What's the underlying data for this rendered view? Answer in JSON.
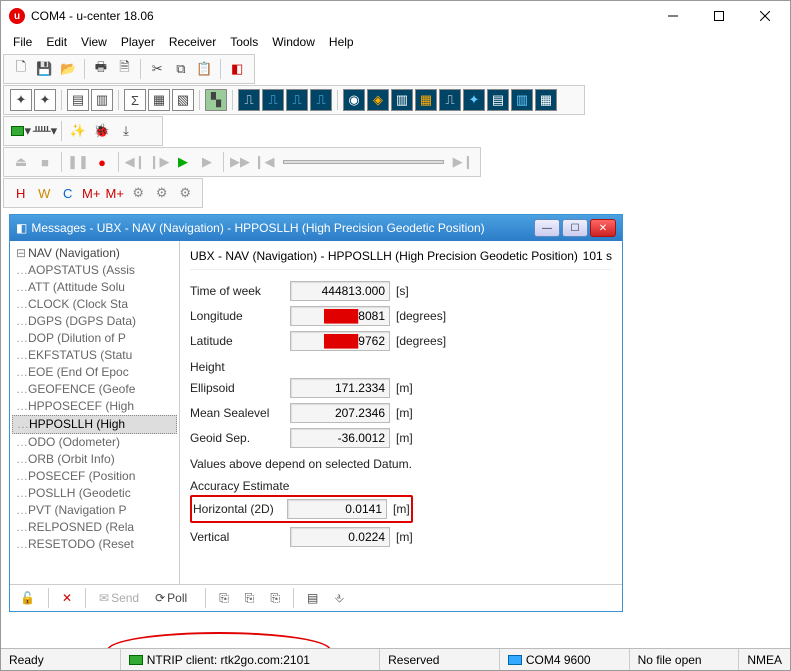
{
  "window": {
    "title": "COM4 - u-center 18.06"
  },
  "menu": [
    "File",
    "Edit",
    "View",
    "Player",
    "Receiver",
    "Tools",
    "Window",
    "Help"
  ],
  "messages": {
    "title": "Messages - UBX - NAV (Navigation) - HPPOSLLH (High Precision Geodetic Position)",
    "tree_root": "NAV (Navigation)",
    "tree": [
      "AOPSTATUS (Assis",
      "ATT (Attitude Solu",
      "CLOCK (Clock Sta",
      "DGPS (DGPS Data)",
      "DOP (Dilution of P",
      "EKFSTATUS (Statu",
      "EOE (End Of Epoc",
      "GEOFENCE (Geofe",
      "HPPOSECEF (High",
      "HPPOSLLH (High",
      "ODO (Odometer)",
      "ORB (Orbit Info)",
      "POSECEF (Position",
      "POSLLH (Geodetic",
      "PVT (Navigation P",
      "RELPOSNED (Rela",
      "RESETODO (Reset"
    ],
    "tree_selected_index": 9,
    "detail": {
      "header": "UBX - NAV (Navigation) - HPPOSLLH (High Precision Geodetic Position)",
      "age": "101 s",
      "time_of_week": {
        "label": "Time of week",
        "value": "444813.000",
        "unit": "[s]"
      },
      "longitude": {
        "label": "Longitude",
        "value": "8081",
        "unit": "[degrees]"
      },
      "latitude": {
        "label": "Latitude",
        "value": "9762",
        "unit": "[degrees]"
      },
      "height_label": "Height",
      "ellipsoid": {
        "label": "Ellipsoid",
        "value": "171.2334",
        "unit": "[m]"
      },
      "msl": {
        "label": "Mean Sealevel",
        "value": "207.2346",
        "unit": "[m]"
      },
      "geoid": {
        "label": "Geoid Sep.",
        "value": "-36.0012",
        "unit": "[m]"
      },
      "datum_note": "Values above depend on selected Datum.",
      "accuracy_label": "Accuracy Estimate",
      "horiz": {
        "label": "Horizontal (2D)",
        "value": "0.0141",
        "unit": "[m]"
      },
      "vert": {
        "label": "Vertical",
        "value": "0.0224",
        "unit": "[m]"
      }
    },
    "toolbar": {
      "send": "Send",
      "poll": "Poll"
    }
  },
  "status": {
    "ready": "Ready",
    "ntrip": "NTRIP client: rtk2go.com:2101",
    "reserved": "Reserved",
    "port": "COM4 9600",
    "file": "No file open",
    "protocol": "NMEA"
  }
}
